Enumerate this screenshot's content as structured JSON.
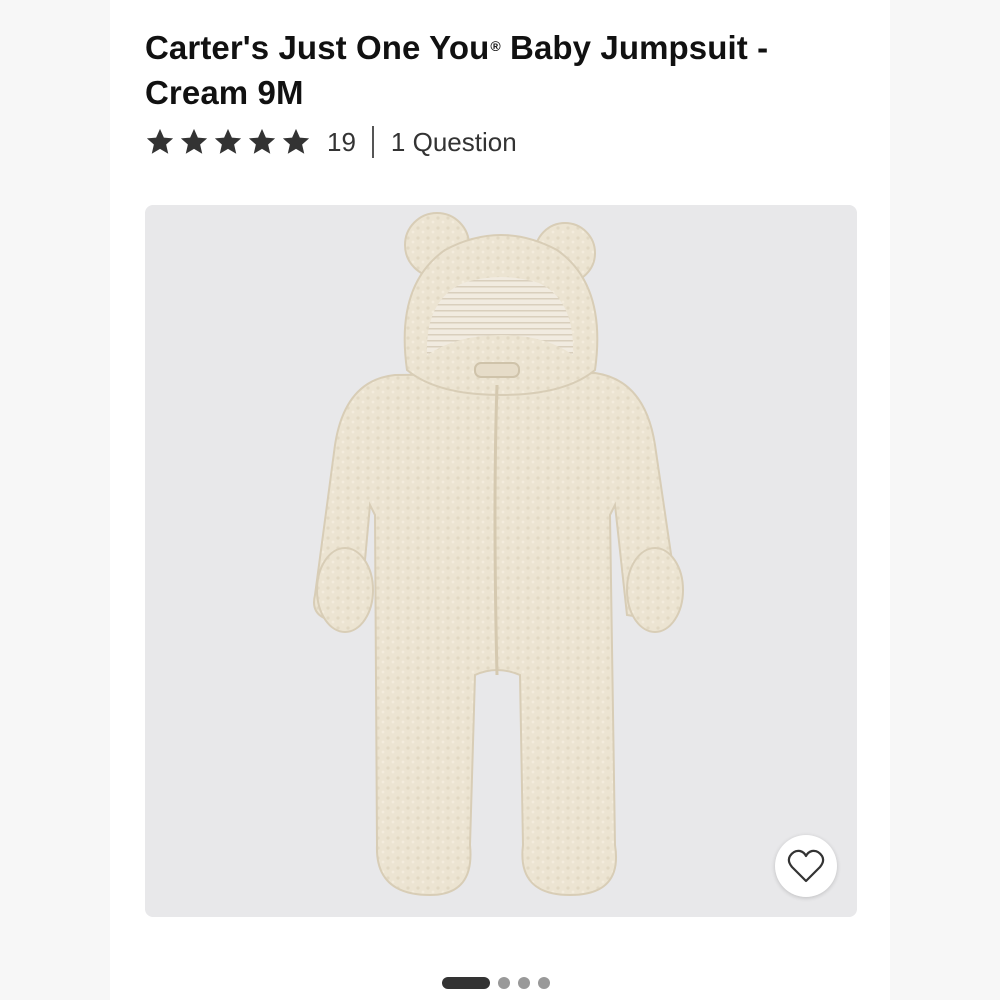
{
  "product": {
    "title": "Carter's Just One You",
    "title_mark": "®",
    "title_rest": " Baby Jumpsuit - Cream 9M",
    "rating": {
      "stars": 5,
      "max_stars": 5
    },
    "review_count": "19",
    "questions_label": "1 Question"
  },
  "image": {
    "alt": "Baby Jumpsuit - Cream",
    "background": "#e8e8ea",
    "garment_color": "#ece4d2"
  },
  "favorite": {
    "icon": "heart-outline-icon"
  },
  "carousel": {
    "count": 4,
    "active_index": 0
  },
  "colors": {
    "text": "#111111",
    "star": "#333333",
    "dot_active": "#333333",
    "dot_inactive": "#999999"
  }
}
